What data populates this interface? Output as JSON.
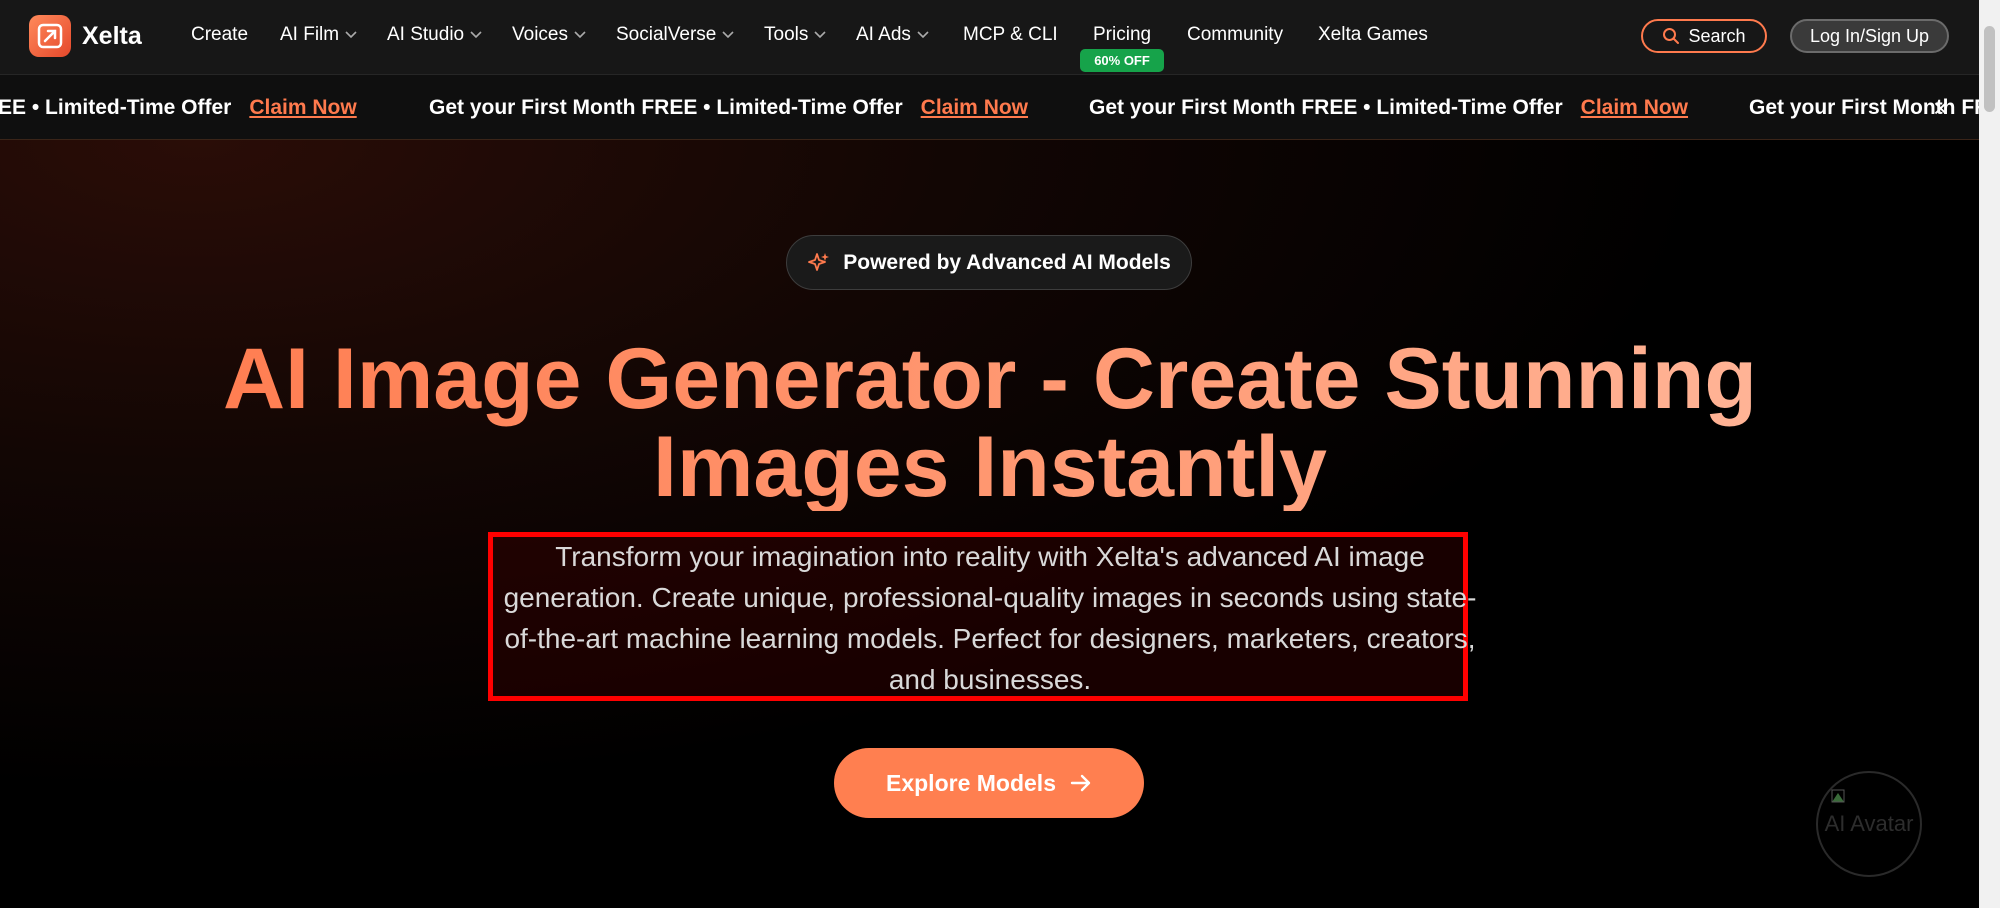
{
  "brand": {
    "name": "Xelta"
  },
  "nav": {
    "items": [
      {
        "label": "Create",
        "has_dropdown": false
      },
      {
        "label": "AI Film",
        "has_dropdown": true
      },
      {
        "label": "AI Studio",
        "has_dropdown": true
      },
      {
        "label": "Voices",
        "has_dropdown": true
      },
      {
        "label": "SocialVerse",
        "has_dropdown": true
      },
      {
        "label": "Tools",
        "has_dropdown": true
      },
      {
        "label": "AI Ads",
        "has_dropdown": true
      },
      {
        "label": "MCP & CLI",
        "has_dropdown": false
      },
      {
        "label": "Pricing",
        "has_dropdown": false
      },
      {
        "label": "Community",
        "has_dropdown": false
      },
      {
        "label": "Xelta Games",
        "has_dropdown": false
      }
    ],
    "pricing_badge": "60% OFF",
    "search_label": "Search",
    "login_label": "Log In/Sign Up"
  },
  "promo": {
    "text": "Get your First Month FREE • Limited-Time Offer",
    "partial_start": "EE • Limited-Time Offer",
    "partial_end": "Get your First Month FR",
    "claim": "Claim Now",
    "close": "×"
  },
  "hero": {
    "badge": "Powered by Advanced AI Models",
    "title": "AI Image Generator - Create Stunning Images Instantly",
    "subtitle": "Transform your imagination into reality with Xelta's advanced AI image generation. Create unique, professional-quality images in seconds using state-of-the-art machine learning models. Perfect for designers, marketers, creators, and businesses.",
    "cta": "Explore Models",
    "avatar_alt": "AI Avatar"
  },
  "colors": {
    "accent": "#ff7a4d",
    "badge_green": "#16a34a",
    "highlight_red": "#ff0000"
  }
}
